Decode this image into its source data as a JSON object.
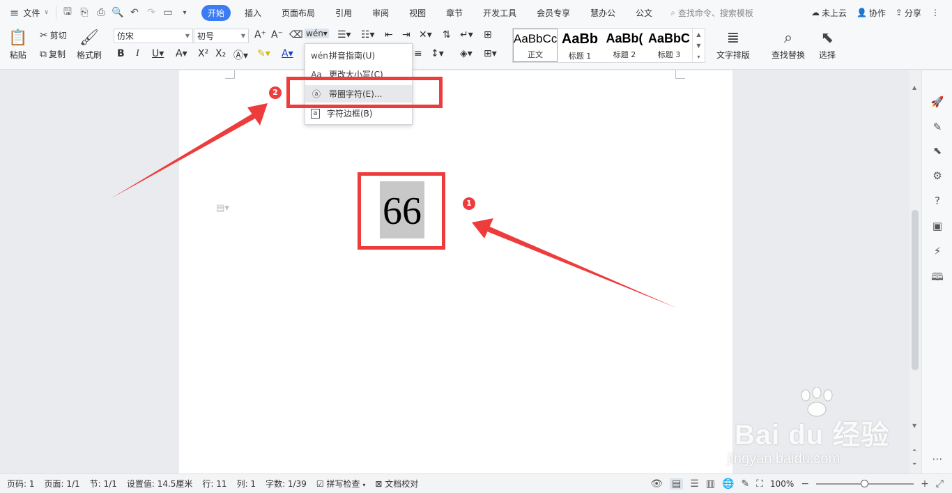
{
  "menubar": {
    "file_label": "文件",
    "tabs": [
      "开始",
      "插入",
      "页面布局",
      "引用",
      "审阅",
      "视图",
      "章节",
      "开发工具",
      "会员专享",
      "慧办公",
      "公文"
    ],
    "active_tab": "开始",
    "search_placeholder": "查找命令、搜索模板",
    "cloud_label": "未上云",
    "collab_label": "协作",
    "share_label": "分享"
  },
  "ribbon": {
    "paste_label": "粘贴",
    "cut_label": "剪切",
    "copy_label": "复制",
    "format_painter_label": "格式刷",
    "font_name": "仿宋",
    "font_size": "初号",
    "styles": [
      {
        "sample": "AaBbCc",
        "name": "正文"
      },
      {
        "sample": "AaBb",
        "name": "标题 1"
      },
      {
        "sample": "AaBb(",
        "name": "标题 2"
      },
      {
        "sample": "AaBbC",
        "name": "标题 3"
      }
    ],
    "text_layout_label": "文字排版",
    "find_replace_label": "查找替换",
    "select_label": "选择"
  },
  "dropdown": {
    "items": [
      {
        "label": "拼音指南(U)",
        "icon": "pinyin-icon"
      },
      {
        "label": "更改大小写(C)",
        "icon": "change-case-icon"
      },
      {
        "label": "带圈字符(E)...",
        "icon": "enclosed-character-icon"
      },
      {
        "label": "字符边框(B)",
        "icon": "character-border-icon"
      }
    ]
  },
  "document": {
    "selected_text": "66"
  },
  "annotations": {
    "badge_1": "1",
    "badge_2": "2",
    "color": "#ee3c3c"
  },
  "watermark": {
    "main": "Bai du 经验",
    "url": "jingyan.baidu.com"
  },
  "statusbar": {
    "page_no": "页码: 1",
    "pages": "页面: 1/1",
    "section": "节: 1/1",
    "setting": "设置值: 14.5厘米",
    "row": "行: 11",
    "col": "列: 1",
    "word_count": "字数: 1/39",
    "spell_check": "拼写检查",
    "doc_proof": "文档校对",
    "zoom": "100%"
  },
  "colors": {
    "accent": "#3b7cf5",
    "annotation_red": "#ee3c3c",
    "selection_gray": "#c8c8c8"
  }
}
